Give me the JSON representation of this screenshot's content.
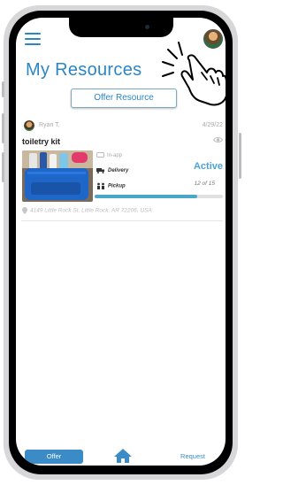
{
  "header": {
    "menu_icon": "hamburger-menu-icon",
    "title": "My Resources",
    "profile_icon": "avatar",
    "pointer_icon": "pointing-hand-icon"
  },
  "actions": {
    "offer_resource_label": "Offer Resource"
  },
  "resource_card": {
    "owner_name": "Ryan T.",
    "date": "4/29/22",
    "item_name": "toiletry kit",
    "visibility_icon": "eye-icon",
    "methods": {
      "in_app": "In-app",
      "delivery": "Delivery",
      "pickup": "Pickup"
    },
    "status": "Active",
    "count_text": "12 of 15",
    "progress_fraction": 0.8,
    "address": "4149 Little Rock St, Little Rock, AR 72206, USA"
  },
  "bottom_nav": {
    "offer_label": "Offer",
    "home_icon": "home-icon",
    "request_label": "Request"
  },
  "colors": {
    "accent": "#2a86c5",
    "status_active": "#4aa3d6",
    "progress": "#49a7c7"
  }
}
